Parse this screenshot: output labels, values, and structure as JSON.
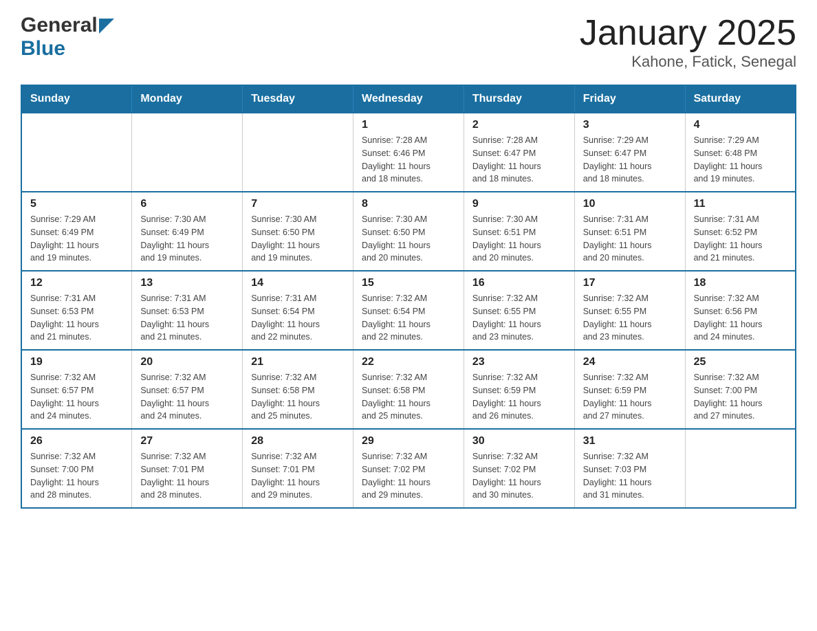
{
  "logo": {
    "general": "General",
    "blue": "Blue"
  },
  "title": "January 2025",
  "subtitle": "Kahone, Fatick, Senegal",
  "days_of_week": [
    "Sunday",
    "Monday",
    "Tuesday",
    "Wednesday",
    "Thursday",
    "Friday",
    "Saturday"
  ],
  "weeks": [
    [
      {
        "day": "",
        "info": ""
      },
      {
        "day": "",
        "info": ""
      },
      {
        "day": "",
        "info": ""
      },
      {
        "day": "1",
        "info": "Sunrise: 7:28 AM\nSunset: 6:46 PM\nDaylight: 11 hours\nand 18 minutes."
      },
      {
        "day": "2",
        "info": "Sunrise: 7:28 AM\nSunset: 6:47 PM\nDaylight: 11 hours\nand 18 minutes."
      },
      {
        "day": "3",
        "info": "Sunrise: 7:29 AM\nSunset: 6:47 PM\nDaylight: 11 hours\nand 18 minutes."
      },
      {
        "day": "4",
        "info": "Sunrise: 7:29 AM\nSunset: 6:48 PM\nDaylight: 11 hours\nand 19 minutes."
      }
    ],
    [
      {
        "day": "5",
        "info": "Sunrise: 7:29 AM\nSunset: 6:49 PM\nDaylight: 11 hours\nand 19 minutes."
      },
      {
        "day": "6",
        "info": "Sunrise: 7:30 AM\nSunset: 6:49 PM\nDaylight: 11 hours\nand 19 minutes."
      },
      {
        "day": "7",
        "info": "Sunrise: 7:30 AM\nSunset: 6:50 PM\nDaylight: 11 hours\nand 19 minutes."
      },
      {
        "day": "8",
        "info": "Sunrise: 7:30 AM\nSunset: 6:50 PM\nDaylight: 11 hours\nand 20 minutes."
      },
      {
        "day": "9",
        "info": "Sunrise: 7:30 AM\nSunset: 6:51 PM\nDaylight: 11 hours\nand 20 minutes."
      },
      {
        "day": "10",
        "info": "Sunrise: 7:31 AM\nSunset: 6:51 PM\nDaylight: 11 hours\nand 20 minutes."
      },
      {
        "day": "11",
        "info": "Sunrise: 7:31 AM\nSunset: 6:52 PM\nDaylight: 11 hours\nand 21 minutes."
      }
    ],
    [
      {
        "day": "12",
        "info": "Sunrise: 7:31 AM\nSunset: 6:53 PM\nDaylight: 11 hours\nand 21 minutes."
      },
      {
        "day": "13",
        "info": "Sunrise: 7:31 AM\nSunset: 6:53 PM\nDaylight: 11 hours\nand 21 minutes."
      },
      {
        "day": "14",
        "info": "Sunrise: 7:31 AM\nSunset: 6:54 PM\nDaylight: 11 hours\nand 22 minutes."
      },
      {
        "day": "15",
        "info": "Sunrise: 7:32 AM\nSunset: 6:54 PM\nDaylight: 11 hours\nand 22 minutes."
      },
      {
        "day": "16",
        "info": "Sunrise: 7:32 AM\nSunset: 6:55 PM\nDaylight: 11 hours\nand 23 minutes."
      },
      {
        "day": "17",
        "info": "Sunrise: 7:32 AM\nSunset: 6:55 PM\nDaylight: 11 hours\nand 23 minutes."
      },
      {
        "day": "18",
        "info": "Sunrise: 7:32 AM\nSunset: 6:56 PM\nDaylight: 11 hours\nand 24 minutes."
      }
    ],
    [
      {
        "day": "19",
        "info": "Sunrise: 7:32 AM\nSunset: 6:57 PM\nDaylight: 11 hours\nand 24 minutes."
      },
      {
        "day": "20",
        "info": "Sunrise: 7:32 AM\nSunset: 6:57 PM\nDaylight: 11 hours\nand 24 minutes."
      },
      {
        "day": "21",
        "info": "Sunrise: 7:32 AM\nSunset: 6:58 PM\nDaylight: 11 hours\nand 25 minutes."
      },
      {
        "day": "22",
        "info": "Sunrise: 7:32 AM\nSunset: 6:58 PM\nDaylight: 11 hours\nand 25 minutes."
      },
      {
        "day": "23",
        "info": "Sunrise: 7:32 AM\nSunset: 6:59 PM\nDaylight: 11 hours\nand 26 minutes."
      },
      {
        "day": "24",
        "info": "Sunrise: 7:32 AM\nSunset: 6:59 PM\nDaylight: 11 hours\nand 27 minutes."
      },
      {
        "day": "25",
        "info": "Sunrise: 7:32 AM\nSunset: 7:00 PM\nDaylight: 11 hours\nand 27 minutes."
      }
    ],
    [
      {
        "day": "26",
        "info": "Sunrise: 7:32 AM\nSunset: 7:00 PM\nDaylight: 11 hours\nand 28 minutes."
      },
      {
        "day": "27",
        "info": "Sunrise: 7:32 AM\nSunset: 7:01 PM\nDaylight: 11 hours\nand 28 minutes."
      },
      {
        "day": "28",
        "info": "Sunrise: 7:32 AM\nSunset: 7:01 PM\nDaylight: 11 hours\nand 29 minutes."
      },
      {
        "day": "29",
        "info": "Sunrise: 7:32 AM\nSunset: 7:02 PM\nDaylight: 11 hours\nand 29 minutes."
      },
      {
        "day": "30",
        "info": "Sunrise: 7:32 AM\nSunset: 7:02 PM\nDaylight: 11 hours\nand 30 minutes."
      },
      {
        "day": "31",
        "info": "Sunrise: 7:32 AM\nSunset: 7:03 PM\nDaylight: 11 hours\nand 31 minutes."
      },
      {
        "day": "",
        "info": ""
      }
    ]
  ]
}
